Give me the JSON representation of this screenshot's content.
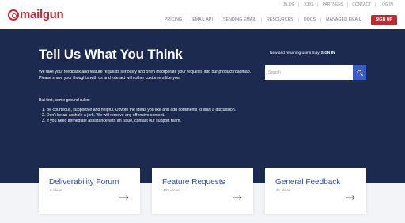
{
  "header": {
    "logo_text": "mailgun",
    "util_links": [
      "BLOG",
      "JOBS",
      "PARTNERS",
      "CONTACT",
      "LOG IN"
    ],
    "nav_items": [
      "PRICING",
      "EMAIL API",
      "SENDING EMAIL",
      "RESOURCES",
      "DOCS",
      "MANAGED EMAIL"
    ],
    "signup_label": "SIGN UP"
  },
  "hero": {
    "title": "Tell Us What You Think",
    "intro": "We take your feedback and feature requests seriously and often incorporate your requests into our product roadmap. Please share your thoughts with us and interact with other customers like you!",
    "rules_intro": "But first, some ground rules:",
    "rule_1": "1. Be courteous, supportive and helpful. Upvote the ideas you like and add comments to start a discussion.",
    "rule_2_prefix": "2. Don't be ",
    "rule_2_strike": "an asshole",
    "rule_2_suffix": " a jerk. We will remove any offensive content.",
    "rule_3": "3. If you need immediate assistance with an issue, contact our support team.",
    "signin_text": "New and returning users may",
    "signin_link": "SIGN IN",
    "search_placeholder": "Search"
  },
  "cards": [
    {
      "title": "Deliverability Forum",
      "count": "6 ideas"
    },
    {
      "title": "Feature Requests",
      "count": "405 ideas"
    },
    {
      "title": "General Feedback",
      "count": "81 ideas"
    }
  ],
  "icons": {
    "search": "search-icon",
    "arrow": "arrow-right-icon"
  },
  "colors": {
    "brand": "#c02a35",
    "hero_bg": "#1b2a4e",
    "accent": "#3a5cc5",
    "card_title": "#2f4b9c"
  }
}
